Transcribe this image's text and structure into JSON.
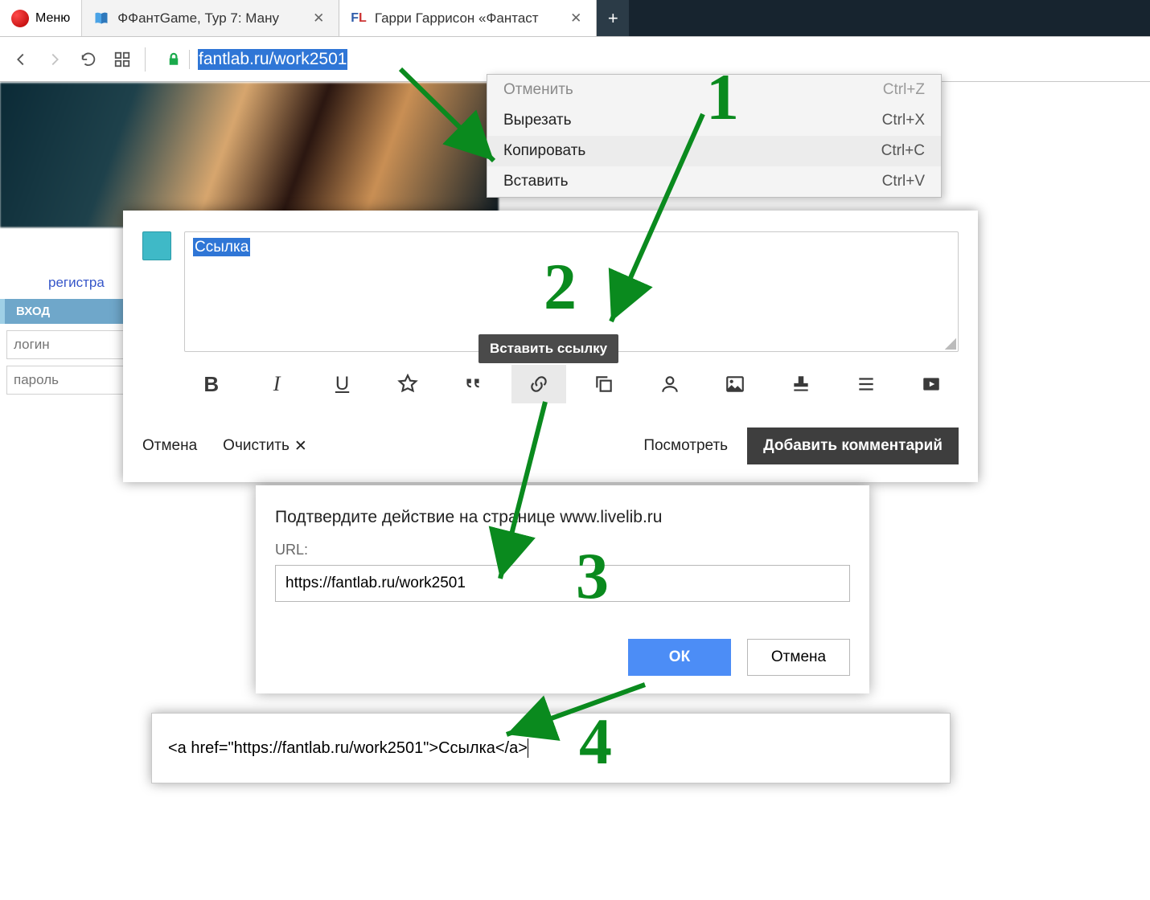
{
  "browser": {
    "menu_label": "Меню",
    "tabs": [
      {
        "title": "ФФантGame, Тур 7: Ману"
      },
      {
        "title": "Гарри Гаррисон «Фантаст"
      }
    ],
    "url_selected": "fantlab.ru/work2501"
  },
  "context_menu": {
    "items": [
      {
        "label": "Отменить",
        "shortcut": "Ctrl+Z",
        "enabled": false
      },
      {
        "label": "Вырезать",
        "shortcut": "Ctrl+X",
        "enabled": true
      },
      {
        "label": "Копировать",
        "shortcut": "Ctrl+C",
        "enabled": true,
        "hover": true
      },
      {
        "label": "Вставить",
        "shortcut": "Ctrl+V",
        "enabled": true
      }
    ]
  },
  "sidebar": {
    "register": "регистра",
    "login_header": "ВХОД",
    "login_placeholder": "логин",
    "password_placeholder": "пароль"
  },
  "editor": {
    "selected_text": "Ссылка",
    "link_tooltip": "Вставить ссылку",
    "cancel": "Отмена",
    "clear": "Очистить",
    "preview": "Посмотреть",
    "submit": "Добавить комментарий"
  },
  "dialog": {
    "title": "Подтвердите действие на странице www.livelib.ru",
    "label": "URL:",
    "value": "https://fantlab.ru/work2501",
    "ok": "ОК",
    "cancel": "Отмена"
  },
  "result_html": "<a href=\"https://fantlab.ru/work2501\">Ссылка</a>",
  "annotations": {
    "n1": "1",
    "n2": "2",
    "n3": "3",
    "n4": "4"
  }
}
